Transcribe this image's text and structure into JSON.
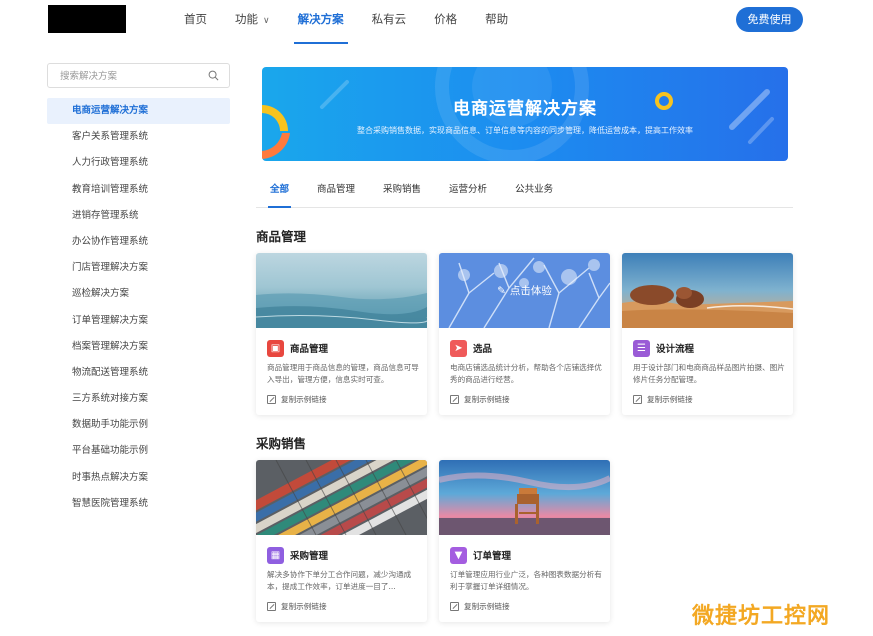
{
  "nav": {
    "items": [
      "首页",
      "功能",
      "解决方案",
      "私有云",
      "价格",
      "帮助"
    ],
    "cta": "免费使用"
  },
  "search": {
    "placeholder": "搜索解决方案"
  },
  "sidebar": {
    "items": [
      "电商运营解决方案",
      "客户关系管理系统",
      "人力行政管理系统",
      "教育培训管理系统",
      "进销存管理系统",
      "办公协作管理系统",
      "门店管理解决方案",
      "巡检解决方案",
      "订单管理解决方案",
      "档案管理解决方案",
      "物流配送管理系统",
      "三方系统对接方案",
      "数据助手功能示例",
      "平台基础功能示例",
      "时事热点解决方案",
      "智慧医院管理系统"
    ]
  },
  "banner": {
    "title": "电商运营解决方案",
    "subtitle": "整合采购销售数据，实现商品信息、订单信息等内容的同步管理，降低运营成本，提高工作效率"
  },
  "tabs": [
    "全部",
    "商品管理",
    "采购销售",
    "运营分析",
    "公共业务"
  ],
  "sections": [
    {
      "title": "商品管理",
      "cards": [
        {
          "title": "商品管理",
          "desc": "商品管理用于商品信息的管理，商品信息可导入导出，管理方便，信息实时可查。",
          "link": "复制示例链接",
          "icon_color": "#e8473f"
        },
        {
          "title": "选品",
          "desc": "电商店铺选品统计分析，帮助各个店铺选择优秀的商品进行经营。",
          "link": "复制示例链接",
          "icon_color": "#ef5a5a",
          "overlay": "点击体验"
        },
        {
          "title": "设计流程",
          "desc": "用于设计部门和电商商品样品图片拍摄、图片修片任务分配管理。",
          "link": "复制示例链接",
          "icon_color": "#9a5bd6"
        }
      ]
    },
    {
      "title": "采购销售",
      "cards": [
        {
          "title": "采购管理",
          "desc": "解决多协作下单分工合作问题，减少沟通成本，提成工作效率，订单进度一目了...",
          "link": "复制示例链接",
          "icon_color": "#8f5fe0"
        },
        {
          "title": "订单管理",
          "desc": "订单管理应用行业广泛，各种图表数据分析有利于掌握订单详细情况。",
          "link": "复制示例链接",
          "icon_color": "#a45de0"
        }
      ]
    }
  ],
  "watermark": "微捷坊工控网"
}
